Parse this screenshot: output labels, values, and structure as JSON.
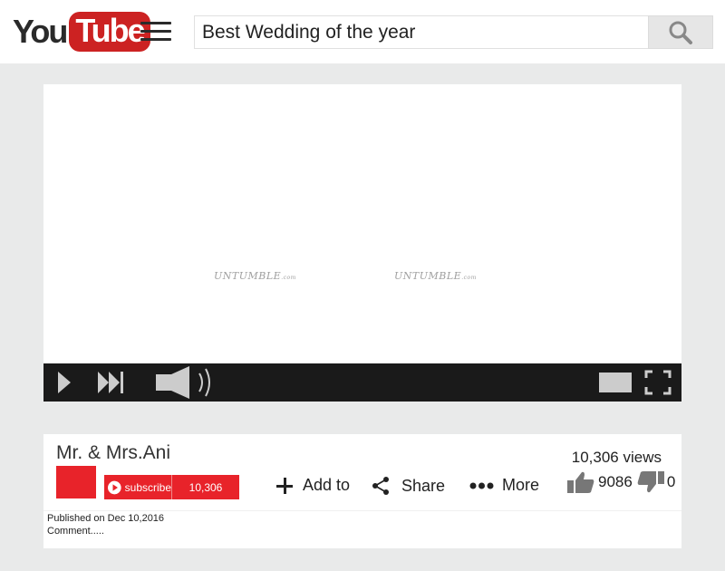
{
  "header": {
    "logo_you": "You",
    "logo_tube": "Tube",
    "search": {
      "value": "Best Wedding of the year"
    }
  },
  "player": {
    "watermarks": [
      "UNTUMBLE",
      "UNTUMBLE"
    ],
    "watermark_suffix": ".com"
  },
  "video_info": {
    "channel_name": "Mr. & Mrs.Ani",
    "subscribe_label": "subscribe",
    "subscriber_count": "10,306",
    "actions": {
      "add_to": "Add to",
      "share": "Share",
      "more": "More"
    },
    "views": "10,306 views",
    "likes": "9086",
    "dislikes": "0",
    "published": "Published on Dec 10,2016",
    "comment": "Comment....."
  },
  "colors": {
    "brand_red": "#cc2222",
    "subscribe_red": "#e8232a",
    "controls_bg": "#1a1a1a",
    "icon_gray": "#777777"
  },
  "icons": [
    "hamburger-menu-icon",
    "search-icon",
    "play-icon",
    "next-icon",
    "volume-icon",
    "theater-mode-icon",
    "fullscreen-icon",
    "plus-icon",
    "share-icon",
    "more-dots-icon",
    "thumbs-up-icon",
    "thumbs-down-icon"
  ]
}
